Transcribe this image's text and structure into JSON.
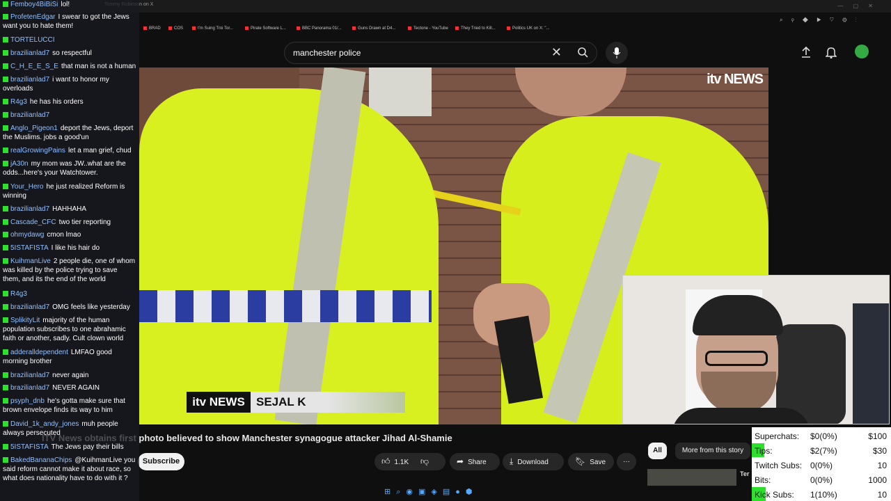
{
  "browser": {
    "tabs": [
      "Tommy Robinson on X"
    ],
    "bookmarks": [
      "BRAD",
      "COS",
      "I'm Suing Troi Tor...",
      "Pirate Software L...",
      "BBC Panorama 01/...",
      "Guns Drawn at D4...",
      "Tectone - YouTube",
      "They Tried to Kill...",
      "Politics UK on X: \"..."
    ]
  },
  "youtube": {
    "search_query": "manchester police",
    "video": {
      "overlay_logo": "itv NEWS",
      "lower_third_logo": "itv NEWS",
      "lower_third_name": "SEJAL K",
      "title": "ITV News obtains first photo believed to show Manchester synagogue attacker Jihad Al-Shamie"
    },
    "actions": {
      "subscribe": "Subscribe",
      "likes": "1.1K",
      "share": "Share",
      "download": "Download",
      "save": "Save",
      "more": "···"
    },
    "chips": {
      "all": "All",
      "story": "More from this story"
    },
    "thumb_text": "Ter"
  },
  "chat": {
    "badge_color": "#2ee02e",
    "messages": [
      {
        "user": "Femboy4BiBiSi",
        "text": "lol!",
        "color": "#8fc0ff"
      },
      {
        "user": "ProfetenEdgar",
        "text": "I swear to got the Jews want you to hate them!",
        "color": "#8fc0ff"
      },
      {
        "user": "TORTELUCCI",
        "text": "",
        "color": "#8fc0ff"
      },
      {
        "user": "brazilianlad7",
        "text": "so respectful",
        "color": "#8fc0ff"
      },
      {
        "user": "C_H_E_E_S_E",
        "text": "that man is not a human",
        "color": "#8fc0ff"
      },
      {
        "user": "brazilianlad7",
        "text": "i want to honor my overloads",
        "color": "#8fc0ff"
      },
      {
        "user": "R4g3",
        "text": "he has his orders",
        "color": "#8fc0ff"
      },
      {
        "user": "brazilianlad7",
        "text": "",
        "color": "#8fc0ff"
      },
      {
        "user": "Anglo_Pigeon1",
        "text": "deport the Jews, deport the Muslims. jobs a good'un",
        "color": "#8fc0ff"
      },
      {
        "user": "realGrowingPains",
        "text": "let a man grief, chud",
        "color": "#8fc0ff"
      },
      {
        "user": "jA30n",
        "text": "my mom was JW..what are the odds...here's your Watchtower.",
        "color": "#8fc0ff"
      },
      {
        "user": "Your_Hero",
        "text": "he just realized Reform is winning",
        "color": "#8fc0ff"
      },
      {
        "user": "brazilianlad7",
        "text": "HAHHAHA",
        "color": "#8fc0ff"
      },
      {
        "user": "Cascade_CFC",
        "text": "two tier reporting",
        "color": "#8fc0ff"
      },
      {
        "user": "ohmydawg",
        "text": "cmon lmao",
        "color": "#8fc0ff"
      },
      {
        "user": "5ISTAFISTA",
        "text": "I like his hair do",
        "color": "#8fc0ff"
      },
      {
        "user": "KuihmanLive",
        "text": "2 people die, one of whom was killed by the police trying to save them, and its the end of the world",
        "color": "#8fc0ff"
      },
      {
        "user": "R4g3",
        "text": "",
        "color": "#8fc0ff"
      },
      {
        "user": "brazilianlad7",
        "text": "OMG feels like yesterday",
        "color": "#8fc0ff"
      },
      {
        "user": "SplikityLit",
        "text": "majority of the human population subscribes to one abrahamic faith or another, sadly. Cult clown world",
        "color": "#8fc0ff"
      },
      {
        "user": "adderalldependent",
        "text": "LMFAO good morning brother",
        "color": "#8fc0ff"
      },
      {
        "user": "brazilianlad7",
        "text": "never again",
        "color": "#8fc0ff"
      },
      {
        "user": "brazilianlad7",
        "text": "NEVER AGAIN",
        "color": "#8fc0ff"
      },
      {
        "user": "psyph_dnb",
        "text": "he's gotta make sure that brown envelope finds its way to him",
        "color": "#8fc0ff"
      },
      {
        "user": "David_1k_andy_jones",
        "text": "muh people always persecuted",
        "color": "#8fc0ff"
      },
      {
        "user": "5ISTAFISTA",
        "text": "The Jews pay their bills",
        "color": "#8fc0ff"
      },
      {
        "user": "BakedBananaChips",
        "text": "@KuihmanLive you said reform cannot make it about race, so what does nationality have to do with it ?",
        "color": "#8fc0ff"
      }
    ]
  },
  "stats": {
    "rows": [
      {
        "label": "Superchats:",
        "value": "$0(0%)",
        "goal": "$100",
        "fill": 0
      },
      {
        "label": "Tips:",
        "value": "$2(7%)",
        "goal": "$30",
        "fill": 0.07
      },
      {
        "label": "Twitch Subs:",
        "value": "0(0%)",
        "goal": "10",
        "fill": 0
      },
      {
        "label": "Bits:",
        "value": "0(0%)",
        "goal": "1000",
        "fill": 0
      },
      {
        "label": "Kick Subs:",
        "value": "1(10%)",
        "goal": "10",
        "fill": 0.1
      }
    ]
  }
}
